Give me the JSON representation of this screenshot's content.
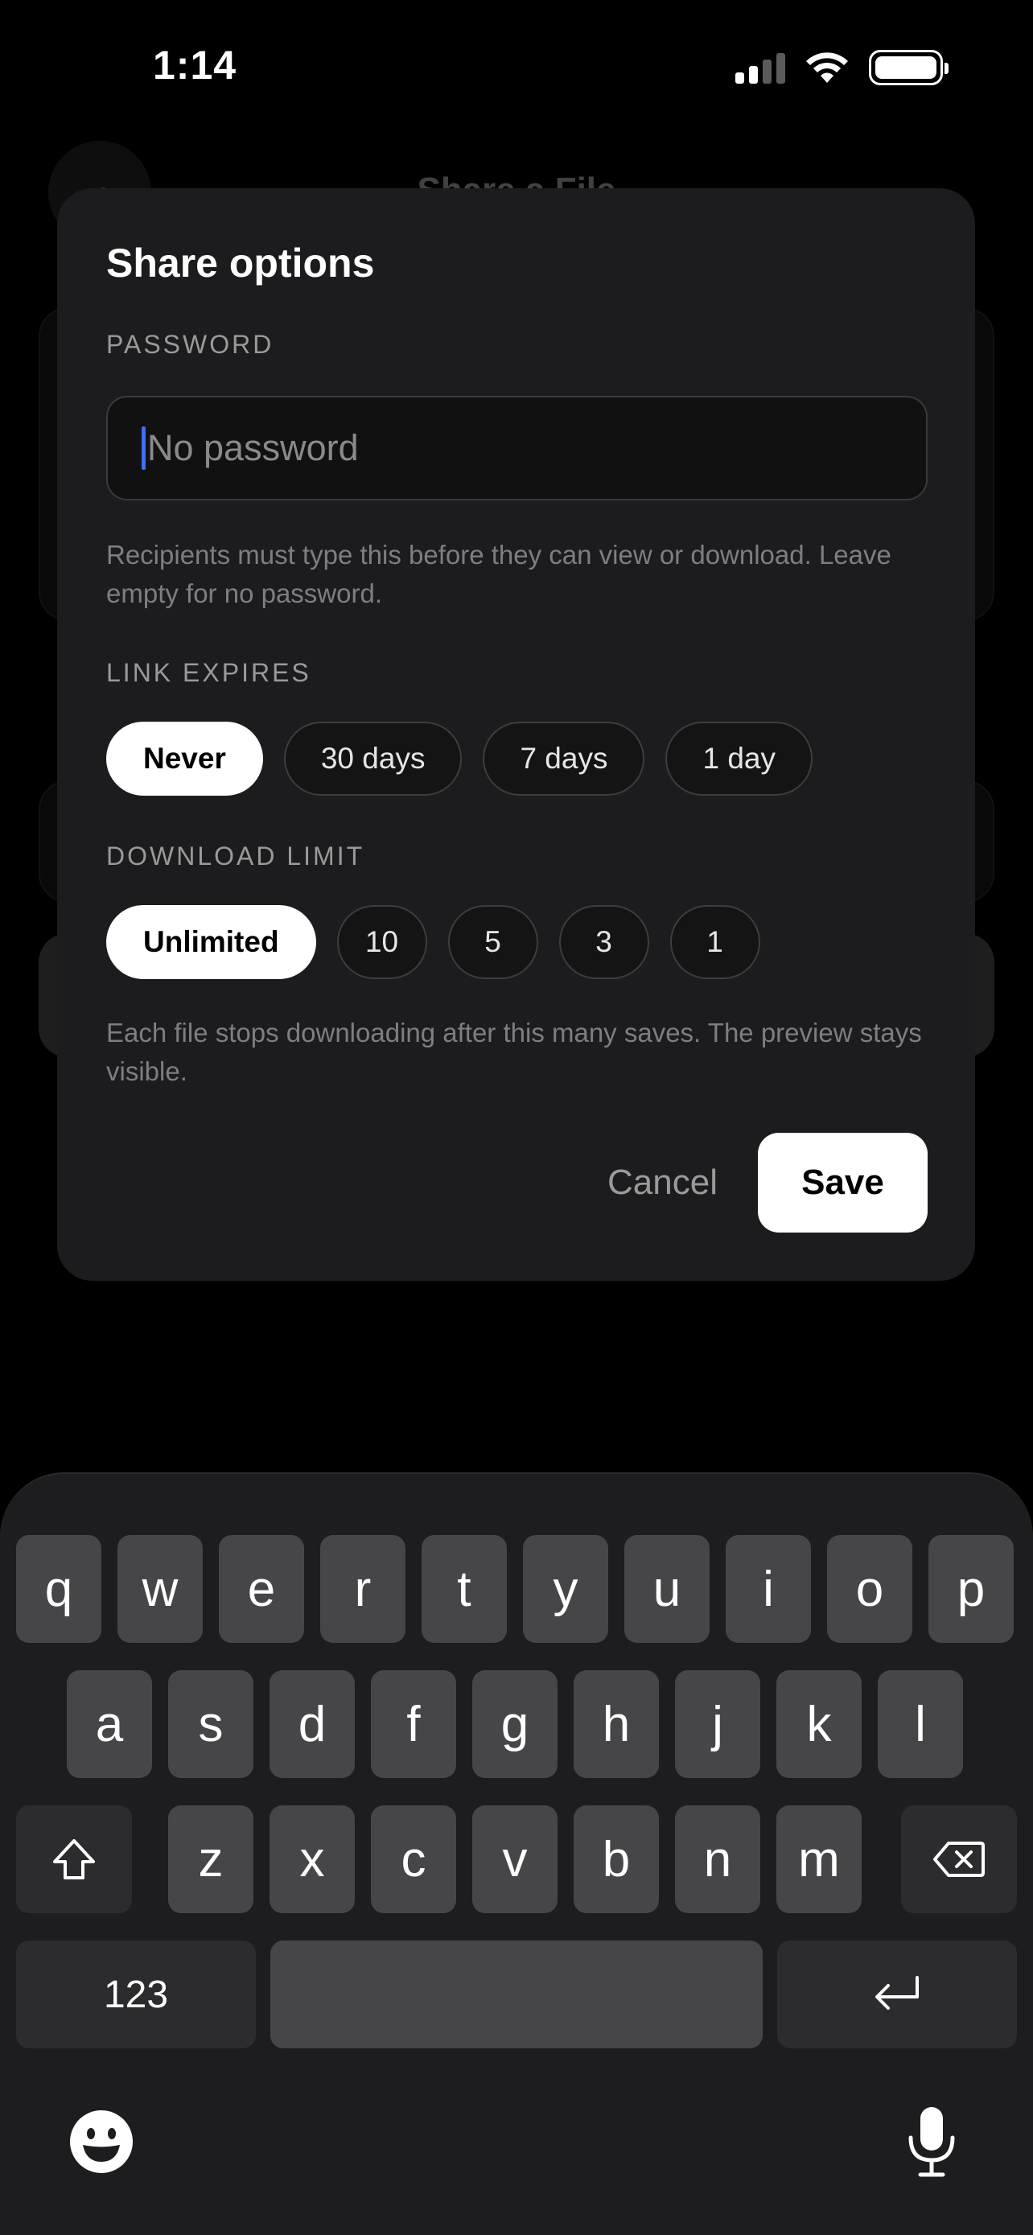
{
  "status_bar": {
    "time": "1:14"
  },
  "background": {
    "back_icon": "‹",
    "title": "Share a File"
  },
  "modal": {
    "title": "Share options",
    "password": {
      "label": "PASSWORD",
      "value": "",
      "placeholder": "No password",
      "hint": "Recipients must type this before they can view or download. Leave empty for no password."
    },
    "link_expires": {
      "label": "LINK EXPIRES",
      "options": [
        "Never",
        "30 days",
        "7 days",
        "1 day"
      ],
      "selected": "Never"
    },
    "download_limit": {
      "label": "DOWNLOAD LIMIT",
      "options": [
        "Unlimited",
        "10",
        "5",
        "3",
        "1"
      ],
      "selected": "Unlimited",
      "hint": "Each file stops downloading after this many saves. The preview stays visible."
    },
    "cancel_label": "Cancel",
    "save_label": "Save"
  },
  "keyboard": {
    "row1": [
      "q",
      "w",
      "e",
      "r",
      "t",
      "y",
      "u",
      "i",
      "o",
      "p"
    ],
    "row2": [
      "a",
      "s",
      "d",
      "f",
      "g",
      "h",
      "j",
      "k",
      "l"
    ],
    "row3": [
      "z",
      "x",
      "c",
      "v",
      "b",
      "n",
      "m"
    ],
    "numbers_label": "123",
    "icons": {
      "shift": "shift-icon",
      "delete": "delete-icon",
      "return": "return-icon",
      "emoji": "emoji-icon",
      "mic": "microphone-icon"
    }
  },
  "colors": {
    "accent_caret": "#3b6ff5",
    "modal_bg": "#1c1c1e",
    "key_bg": "#464649"
  }
}
